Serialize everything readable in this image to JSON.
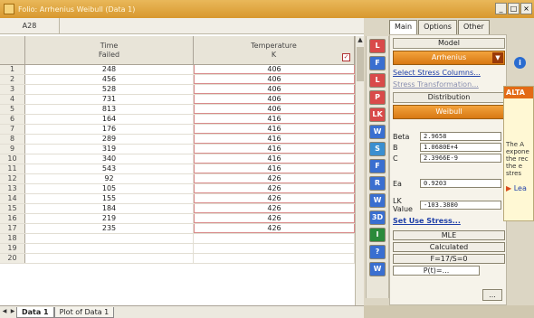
{
  "window": {
    "title": "Folio: Arrhenius Weibull (Data 1)",
    "buttons": [
      "_",
      "□",
      "×"
    ]
  },
  "cellbar": {
    "ref": "A28",
    "formula": ""
  },
  "sheet": {
    "columns": [
      {
        "line1": "Time",
        "line2": "Failed"
      },
      {
        "line1": "Temperature",
        "line2": "K"
      }
    ],
    "rows": [
      {
        "n": "1",
        "time": "248",
        "temp": "406"
      },
      {
        "n": "2",
        "time": "456",
        "temp": "406"
      },
      {
        "n": "3",
        "time": "528",
        "temp": "406"
      },
      {
        "n": "4",
        "time": "731",
        "temp": "406"
      },
      {
        "n": "5",
        "time": "813",
        "temp": "406"
      },
      {
        "n": "6",
        "time": "164",
        "temp": "416"
      },
      {
        "n": "7",
        "time": "176",
        "temp": "416"
      },
      {
        "n": "8",
        "time": "289",
        "temp": "416"
      },
      {
        "n": "9",
        "time": "319",
        "temp": "416"
      },
      {
        "n": "10",
        "time": "340",
        "temp": "416"
      },
      {
        "n": "11",
        "time": "543",
        "temp": "416"
      },
      {
        "n": "12",
        "time": "92",
        "temp": "426"
      },
      {
        "n": "13",
        "time": "105",
        "temp": "426"
      },
      {
        "n": "14",
        "time": "155",
        "temp": "426"
      },
      {
        "n": "15",
        "time": "184",
        "temp": "426"
      },
      {
        "n": "16",
        "time": "219",
        "temp": "426"
      },
      {
        "n": "17",
        "time": "235",
        "temp": "426"
      },
      {
        "n": "18",
        "time": "",
        "temp": ""
      },
      {
        "n": "19",
        "time": "",
        "temp": ""
      },
      {
        "n": "20",
        "time": "",
        "temp": ""
      }
    ],
    "tabs": [
      "Data 1",
      "Plot of Data 1"
    ]
  },
  "tools": [
    "L",
    "F",
    "L",
    "P",
    "LK",
    "W",
    "S",
    "F",
    "R",
    "W",
    "3D",
    "I",
    "?",
    "W"
  ],
  "panel": {
    "tabs": [
      "Main",
      "Options",
      "Other"
    ],
    "model_header": "Model",
    "model_value": "Arrhenius",
    "select_stress": "Select Stress Columns...",
    "stress_transform": "Stress Transformation...",
    "dist_header": "Distribution",
    "dist_value": "Weibull",
    "params": [
      {
        "label": "Beta",
        "value": "2.9658"
      },
      {
        "label": "B",
        "value": "1.0680E+4"
      },
      {
        "label": "C",
        "value": "2.3966E-9"
      }
    ],
    "ea": {
      "label": "Ea",
      "value": "0.9203"
    },
    "lk": {
      "label": "LK Value",
      "value": "-103.3880"
    },
    "set_use_stress": "Set Use Stress...",
    "mle": "MLE",
    "calculated": "Calculated",
    "fs": "F=17/S=0",
    "pt": "P(t)=...",
    "more": "..."
  },
  "tooltip": {
    "head": "ALTA",
    "body": "The A expone the rec the e stres",
    "link": "Lea"
  },
  "colors": {
    "accent": "#e0861e",
    "link": "#2040a8",
    "titlebar": "#d8982e"
  }
}
